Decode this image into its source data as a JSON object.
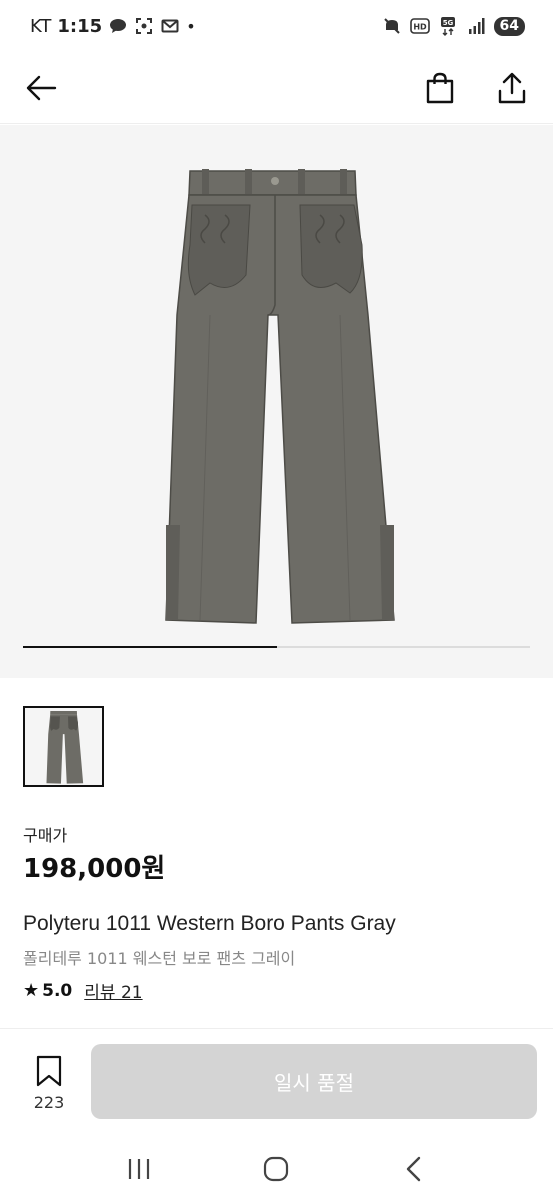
{
  "status_bar": {
    "carrier": "KT",
    "time": "1:15",
    "dot": "•",
    "battery": "64",
    "icons": [
      "chat-bubble-icon",
      "screenshot-icon",
      "mail-icon",
      "mute-icon",
      "hd-icon",
      "5g-icon",
      "signal-icon"
    ]
  },
  "header": {
    "back_icon": "back-arrow-icon",
    "cart_icon": "shopping-bag-icon",
    "share_icon": "share-icon"
  },
  "gallery": {
    "progress": 0.5
  },
  "product": {
    "price_label": "구매가",
    "price": "198,000원",
    "title_en": "Polyteru 1011 Western Boro Pants Gray",
    "title_ko": "폴리테루 1011 웨스턴 보로 팬츠 그레이",
    "rating": "5.0",
    "review_text": "리뷰 21"
  },
  "actions": {
    "wish_count": "223",
    "main_button": "일시 품절"
  },
  "colors": {
    "pants": "#6d6c66",
    "pants_dark": "#55544f",
    "disabled_button": "#d4d4d4"
  }
}
